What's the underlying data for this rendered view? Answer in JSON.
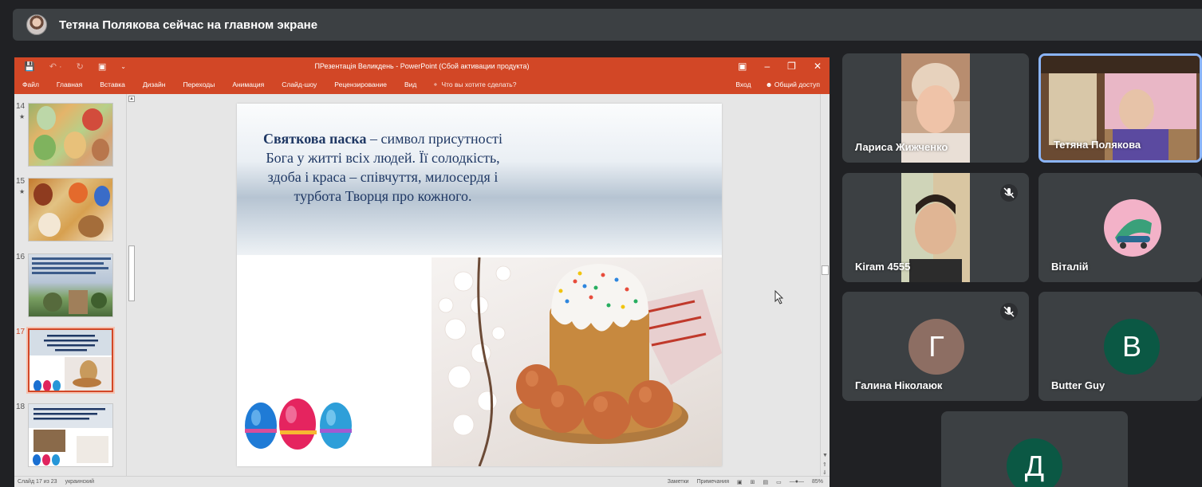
{
  "presenting_bar": {
    "text": "Тетяна Полякова сейчас на главном экране"
  },
  "powerpoint": {
    "title": "ПРезентація Великдень - PowerPoint (Сбой активации продукта)",
    "menu_tabs": [
      "Файл",
      "Главная",
      "Вставка",
      "Дизайн",
      "Переходы",
      "Анимация",
      "Слайд-шоу",
      "Рецензирование",
      "Вид"
    ],
    "tell_me": "Что вы хотите сделать?",
    "sign_in": "Вход",
    "share": "Общий доступ",
    "thumbnails": [
      {
        "number": "14",
        "star": "★"
      },
      {
        "number": "15",
        "star": "★"
      },
      {
        "number": "16",
        "star": ""
      },
      {
        "number": "17",
        "star": "",
        "selected": true
      },
      {
        "number": "18",
        "star": ""
      }
    ],
    "slide_text_bold": "Святкова паска",
    "slide_text_rest": " – символ присутності Бога у житті всіх людей. Її солодкість, здоба і краса – співчуття, милосердя і турбота Творця про кожного.",
    "status_left": "Слайд 17 из 23",
    "status_lang": "украинский",
    "status_notes": "Заметки",
    "status_comments": "Примечания",
    "zoom": "85%"
  },
  "participants": [
    {
      "name": "Лариса Жижченко",
      "type": "video",
      "muted": false
    },
    {
      "name": "Тетяна Полякова",
      "type": "video",
      "muted": false,
      "active": true
    },
    {
      "name": "Kiram 4555",
      "type": "video",
      "muted": true
    },
    {
      "name": "Віталій",
      "type": "avatar-image",
      "muted": false
    },
    {
      "name": "Галина Ніколаюк",
      "type": "initial",
      "initial": "Г",
      "color": "#8d6e63",
      "muted": true
    },
    {
      "name": "Butter Guy",
      "type": "initial",
      "initial": "B",
      "color": "#0b5844",
      "muted": false
    },
    {
      "name": "",
      "type": "initial",
      "initial": "Д",
      "color": "#0b5844",
      "muted": false
    }
  ]
}
